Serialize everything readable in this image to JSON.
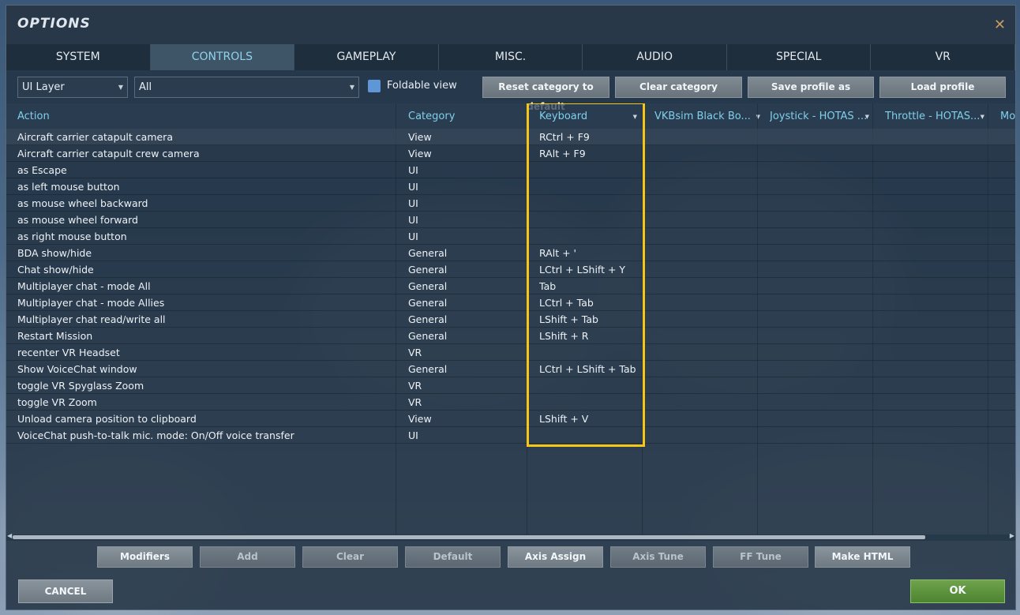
{
  "window": {
    "title": "OPTIONS"
  },
  "tabs": [
    {
      "label": "SYSTEM"
    },
    {
      "label": "CONTROLS"
    },
    {
      "label": "GAMEPLAY"
    },
    {
      "label": "MISC."
    },
    {
      "label": "AUDIO"
    },
    {
      "label": "SPECIAL"
    },
    {
      "label": "VR"
    }
  ],
  "active_tab": "CONTROLS",
  "toolbar": {
    "layer_select": "UI Layer",
    "filter_select": "All",
    "foldable_view_label": "Foldable view",
    "foldable_view_checked": true,
    "reset_label": "Reset category to default",
    "clear_category_label": "Clear category",
    "save_profile_label": "Save profile as",
    "load_profile_label": "Load profile"
  },
  "table": {
    "headers": {
      "action": "Action",
      "category": "Category",
      "keyboard": "Keyboard",
      "device1": "VKBsim Black Bo...",
      "device2": "Joystick - HOTAS ...",
      "device3": "Throttle - HOTAS...",
      "device4": "Mou"
    },
    "rows": [
      {
        "action": "Aircraft carrier catapult camera",
        "category": "View",
        "keyboard": "RCtrl + F9"
      },
      {
        "action": "Aircraft carrier catapult crew camera",
        "category": "View",
        "keyboard": "RAlt + F9"
      },
      {
        "action": "as Escape",
        "category": "UI",
        "keyboard": ""
      },
      {
        "action": "as left mouse button",
        "category": "UI",
        "keyboard": ""
      },
      {
        "action": "as mouse wheel backward",
        "category": "UI",
        "keyboard": ""
      },
      {
        "action": "as mouse wheel forward",
        "category": "UI",
        "keyboard": ""
      },
      {
        "action": "as right mouse button",
        "category": "UI",
        "keyboard": ""
      },
      {
        "action": "BDA show/hide",
        "category": "General",
        "keyboard": "RAlt + '"
      },
      {
        "action": "Chat show/hide",
        "category": "General",
        "keyboard": "LCtrl + LShift + Y"
      },
      {
        "action": "Multiplayer chat - mode All",
        "category": "General",
        "keyboard": "Tab"
      },
      {
        "action": "Multiplayer chat - mode Allies",
        "category": "General",
        "keyboard": "LCtrl + Tab"
      },
      {
        "action": "Multiplayer chat read/write all",
        "category": "General",
        "keyboard": "LShift + Tab"
      },
      {
        "action": "Restart Mission",
        "category": "General",
        "keyboard": "LShift + R"
      },
      {
        "action": "recenter VR Headset",
        "category": "VR",
        "keyboard": ""
      },
      {
        "action": "Show VoiceChat window",
        "category": "General",
        "keyboard": "LCtrl + LShift + Tab"
      },
      {
        "action": "toggle VR Spyglass Zoom",
        "category": "VR",
        "keyboard": ""
      },
      {
        "action": "toggle VR Zoom",
        "category": "VR",
        "keyboard": ""
      },
      {
        "action": "Unload camera position to clipboard",
        "category": "View",
        "keyboard": "LShift + V"
      },
      {
        "action": "VoiceChat push-to-talk mic. mode: On/Off voice transfer",
        "category": "UI",
        "keyboard": ""
      }
    ]
  },
  "bottom_buttons": [
    {
      "label": "Modifiers",
      "enabled": true
    },
    {
      "label": "Add",
      "enabled": false
    },
    {
      "label": "Clear",
      "enabled": false
    },
    {
      "label": "Default",
      "enabled": false
    },
    {
      "label": "Axis Assign",
      "enabled": true
    },
    {
      "label": "Axis Tune",
      "enabled": false
    },
    {
      "label": "FF Tune",
      "enabled": false
    },
    {
      "label": "Make HTML",
      "enabled": true
    }
  ],
  "footer": {
    "cancel_label": "CANCEL",
    "ok_label": "OK"
  },
  "colors": {
    "highlight": "#f5c518",
    "header_text": "#7fd0ec",
    "ok_green": "#5a9238",
    "close": "#c99a64"
  }
}
